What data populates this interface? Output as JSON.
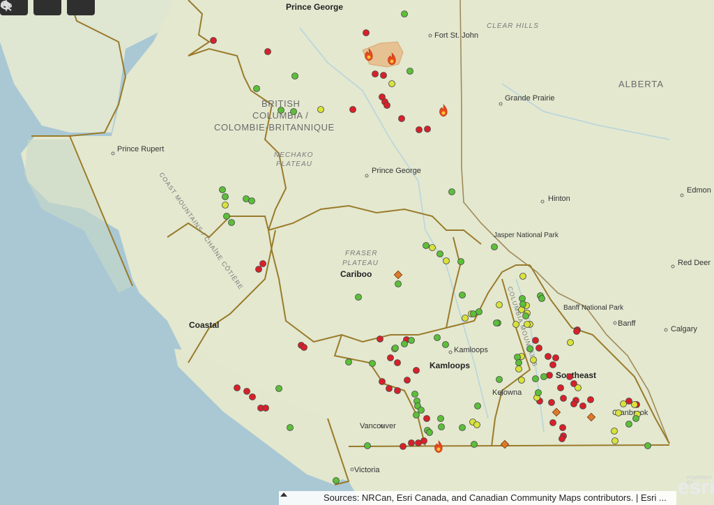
{
  "toolbar": {
    "buttons": [
      {
        "name": "locate-button",
        "icon": "crosshair-icon"
      },
      {
        "name": "search-button",
        "icon": "search-icon"
      },
      {
        "name": "layers-button",
        "icon": "layers-icon"
      }
    ]
  },
  "labels": {
    "provinces": {
      "bc_line1": "BRITISH",
      "bc_line2": "COLUMBIA /",
      "bc_line3": "COLOMBIE-BRITANNIQUE",
      "alberta": "ALBERTA"
    },
    "features": {
      "nechako1": "NECHAKO",
      "nechako2": "PLATEAU",
      "fraser1": "FRASER",
      "fraser2": "PLATEAU",
      "coast_mountains": "COAST MOUNTAINS / CHAÎNE CÔTIÈRE",
      "columbia_mountains": "COLUMBIA MOUNTAINS",
      "clear_hills": "CLEAR HILLS"
    },
    "cities": {
      "fort_st_john": "Fort St. John",
      "grande_prairie": "Grande Prairie",
      "prince_rupert": "Prince Rupert",
      "prince_george": "Prince George",
      "hinton": "Hinton",
      "edmonton": "Edmon",
      "red_deer": "Red Deer",
      "jasper": "Jasper National Park",
      "banff_np": "Banff National Park",
      "banff": "Banff",
      "calgary": "Calgary",
      "kamloops_city": "Kamloops",
      "kelowna": "Kelowna",
      "vancouver": "Vancouver",
      "victoria": "Victoria",
      "cranbrook": "Cranbrook"
    },
    "regions": {
      "prince_george": "Prince George",
      "cariboo": "Cariboo",
      "coastal": "Coastal",
      "kamloops": "Kamloops",
      "southeast": "Southeast"
    }
  },
  "attribution": "Sources: NRCan, Esri Canada, and Canadian Community Maps contributors. | Esri ...",
  "logo": {
    "brand": "esri",
    "powered": "POWERED BY"
  },
  "colors": {
    "water": "#a9c8d4",
    "land": "#e3e8cf",
    "boundary": "#9a7a2a",
    "red": "#d8202a",
    "yellow": "#d8e23a",
    "green": "#5cbf3a",
    "orange": "#e0782a"
  },
  "fire_counts": {
    "red": 59,
    "yellow": 31,
    "green": 62,
    "orange": 4,
    "fire_icons": 4
  }
}
